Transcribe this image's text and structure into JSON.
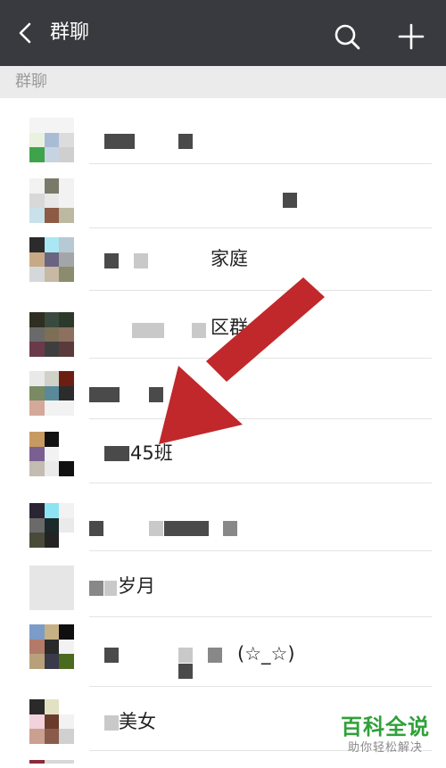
{
  "header": {
    "title": "群聊",
    "back_icon": "chevron-left-icon",
    "search_icon": "search-icon",
    "add_icon": "plus-icon",
    "bg_color": "#393a3f"
  },
  "section": {
    "label": "群聊"
  },
  "groups": [
    {
      "name": ""
    },
    {
      "name": ""
    },
    {
      "name": "家庭"
    },
    {
      "name": "区群"
    },
    {
      "name": ""
    },
    {
      "name": "45班"
    },
    {
      "name": ""
    },
    {
      "name": "岁月"
    },
    {
      "name": "(☆_☆)"
    },
    {
      "name": "美女"
    }
  ],
  "watermark": {
    "main": "百科全说",
    "sub": "助你轻松解决"
  },
  "annotation": {
    "arrow_color": "#c0282b"
  }
}
